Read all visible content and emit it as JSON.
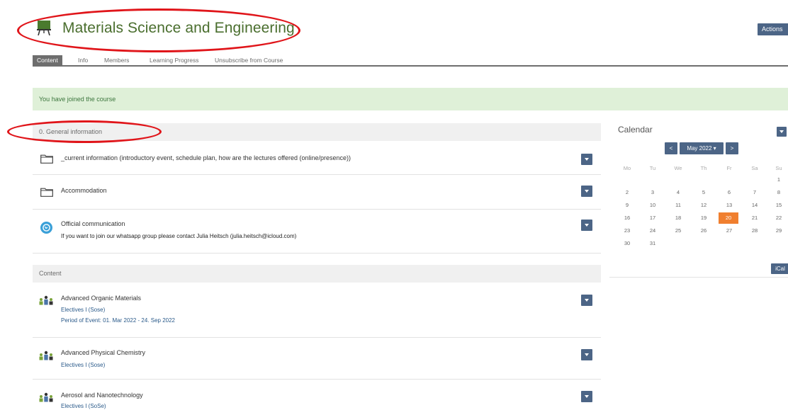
{
  "header": {
    "course_title": "Materials Science and Engineering",
    "actions_label": "Actions"
  },
  "tabs": [
    {
      "label": "Content",
      "active": true
    },
    {
      "label": "Info",
      "active": false
    },
    {
      "label": "Members",
      "active": false
    },
    {
      "label": "Learning Progress",
      "active": false
    },
    {
      "label": "Unsubscribe from Course",
      "active": false
    }
  ],
  "message": "You have joined the course",
  "general_section": {
    "title": "0. General information",
    "items": [
      {
        "icon": "folder-icon",
        "title": "_current information (introductory event, schedule plan, how are the lectures offered (online/presence))"
      },
      {
        "icon": "folder-icon",
        "title": "Accommodation"
      },
      {
        "icon": "whatsapp-icon",
        "title": "Official communication",
        "description": "If you want to join our whatsapp group please contact Julia Heitsch (julia.heitsch@icloud.com)"
      }
    ]
  },
  "content_section": {
    "title": "Content",
    "items": [
      {
        "icon": "group-icon",
        "title": "Advanced Organic Materials",
        "sub1": "Electives I (Sose)",
        "sub2": "Period of Event: 01. Mar 2022 - 24. Sep 2022"
      },
      {
        "icon": "group-icon",
        "title": "Advanced Physical Chemistry",
        "sub1": "Electives I (Sose)"
      },
      {
        "icon": "group-icon",
        "title": "Aerosol and Nanotechnology",
        "sub1": "Electives I (SoSe)"
      }
    ]
  },
  "calendar": {
    "title": "Calendar",
    "prev": "<",
    "next": ">",
    "month_label": "May 2022 ▾",
    "weekdays": [
      "Mo",
      "Tu",
      "We",
      "Th",
      "Fr",
      "Sa",
      "Su"
    ],
    "weeks": [
      [
        "",
        "",
        "",
        "",
        "",
        "",
        "1"
      ],
      [
        "2",
        "3",
        "4",
        "5",
        "6",
        "7",
        "8"
      ],
      [
        "9",
        "10",
        "11",
        "12",
        "13",
        "14",
        "15"
      ],
      [
        "16",
        "17",
        "18",
        "19",
        "20",
        "21",
        "22"
      ],
      [
        "23",
        "24",
        "25",
        "26",
        "27",
        "28",
        "29"
      ],
      [
        "30",
        "31",
        "",
        "",
        "",
        "",
        ""
      ]
    ],
    "today": "20",
    "ical_label": "iCal"
  },
  "colors": {
    "title_green": "#4a6e2e",
    "button_blue": "#4c6586",
    "today_orange": "#f07f2f",
    "success_bg": "#dff0d8",
    "annotation_red": "#e0151a"
  }
}
